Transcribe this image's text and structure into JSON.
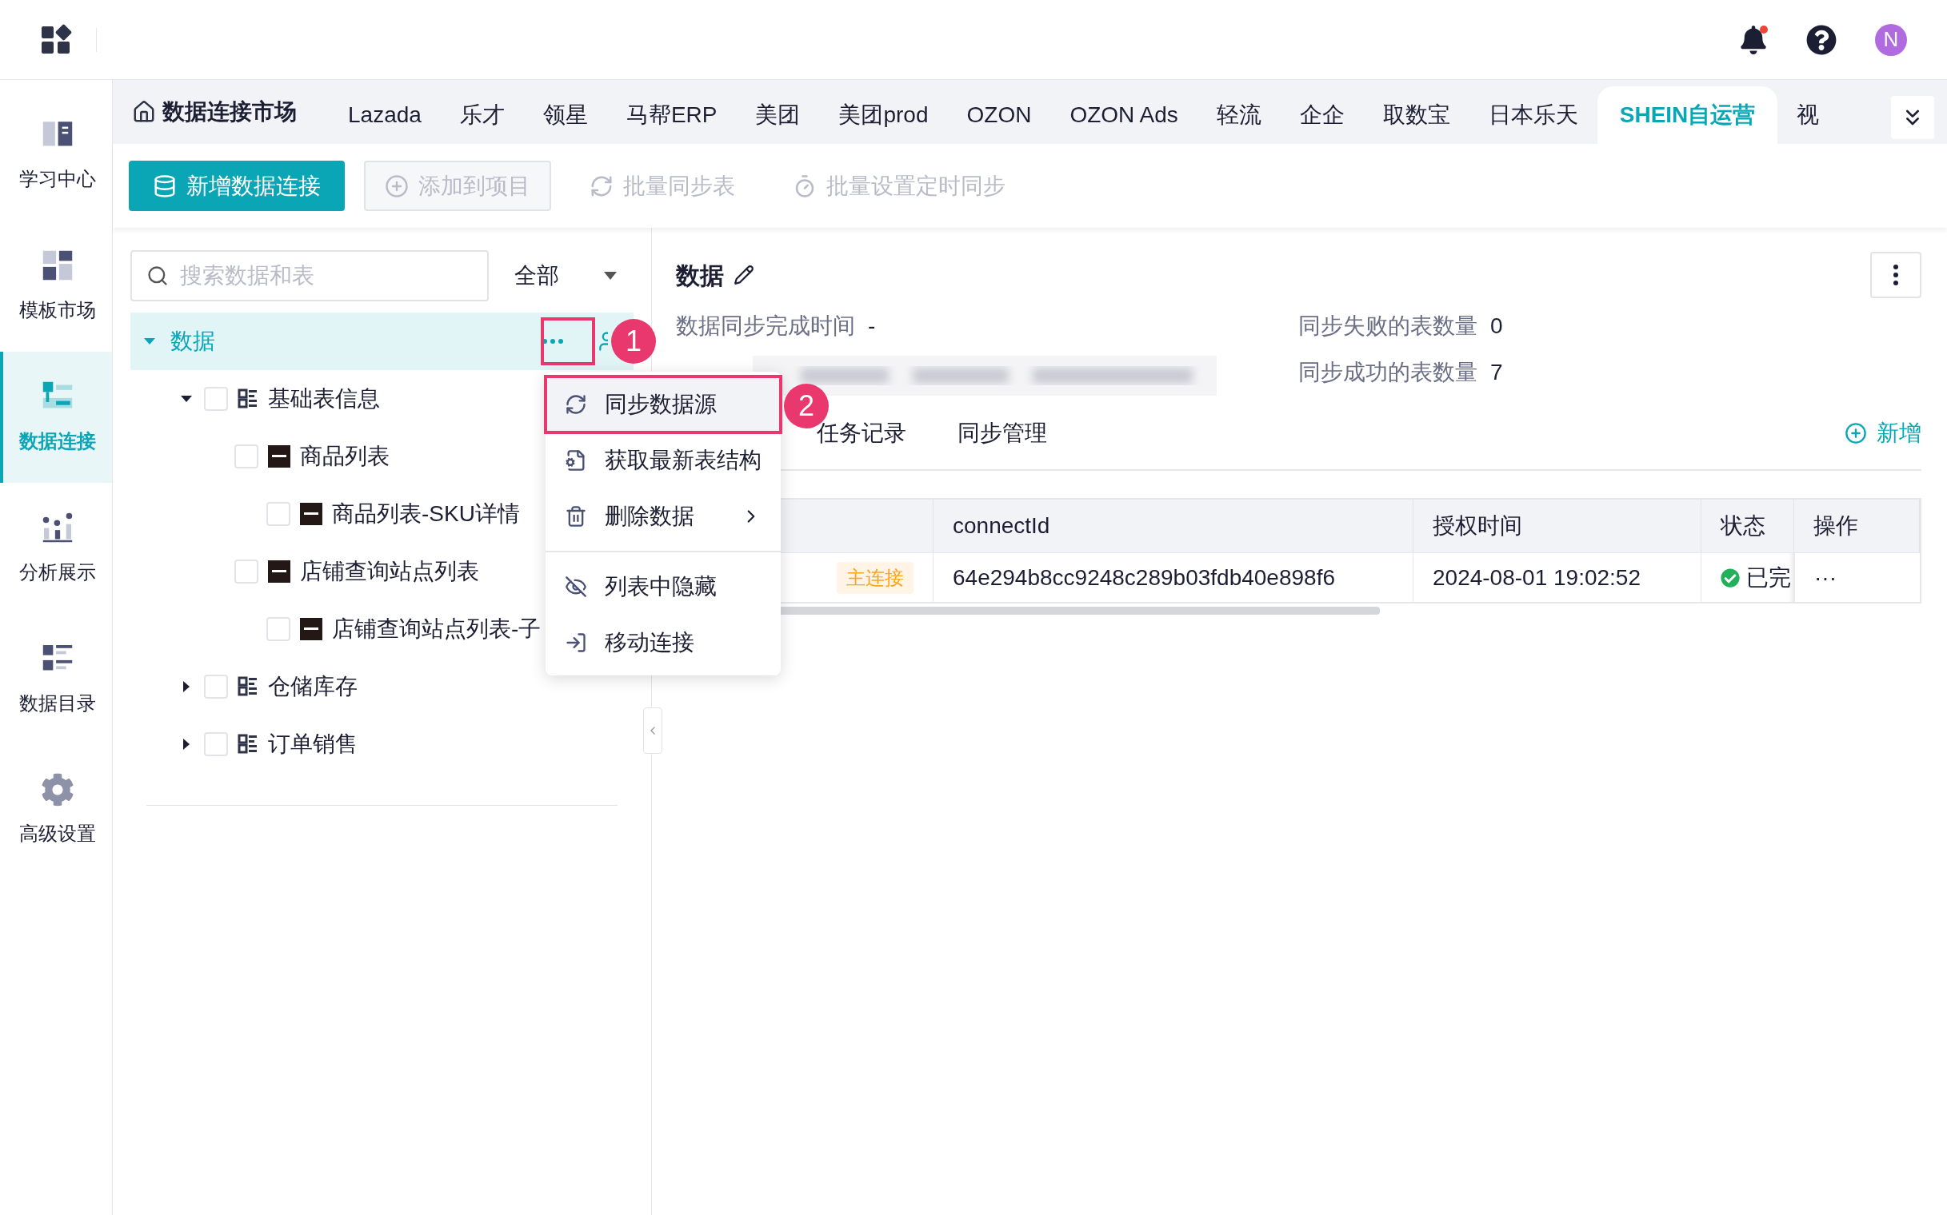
{
  "header": {
    "avatar": "N"
  },
  "sidebar": {
    "items": [
      {
        "label": "学习中心",
        "selected": false
      },
      {
        "label": "模板市场",
        "selected": false
      },
      {
        "label": "数据连接",
        "selected": true
      },
      {
        "label": "分析展示",
        "selected": false
      },
      {
        "label": "数据目录",
        "selected": false
      },
      {
        "label": "高级设置",
        "selected": false
      }
    ]
  },
  "market_tabs": {
    "home": "数据连接市场",
    "tabs": [
      {
        "label": "Lazada",
        "selected": false
      },
      {
        "label": "乐才",
        "selected": false
      },
      {
        "label": "领星",
        "selected": false
      },
      {
        "label": "马帮ERP",
        "selected": false
      },
      {
        "label": "美团",
        "selected": false
      },
      {
        "label": "美团prod",
        "selected": false
      },
      {
        "label": "OZON",
        "selected": false
      },
      {
        "label": "OZON Ads",
        "selected": false
      },
      {
        "label": "轻流",
        "selected": false
      },
      {
        "label": "企企",
        "selected": false
      },
      {
        "label": "取数宝",
        "selected": false
      },
      {
        "label": "日本乐天",
        "selected": false
      },
      {
        "label": "SHEIN自运营",
        "selected": true
      },
      {
        "label": "视",
        "selected": false
      }
    ]
  },
  "toolbar": {
    "buttons": [
      {
        "label": "新增数据连接",
        "kind": "primary",
        "disabled": false
      },
      {
        "label": "添加到项目",
        "kind": "outline",
        "disabled": true
      },
      {
        "label": "批量同步表",
        "kind": "text",
        "disabled": true
      },
      {
        "label": "批量设置定时同步",
        "kind": "text",
        "disabled": true
      }
    ]
  },
  "tree": {
    "search_placeholder": "搜索数据和表",
    "filter": "全部",
    "nodes": [
      {
        "label": "数据",
        "kind": "root",
        "expanded": true,
        "selected": true,
        "children": [
          {
            "label": "基础表信息",
            "kind": "folder",
            "expanded": true,
            "checked": false,
            "children": [
              {
                "label": "商品列表",
                "kind": "table",
                "checked": false,
                "children": [
                  {
                    "label": "商品列表-SKU详情",
                    "kind": "table",
                    "checked": false
                  }
                ]
              },
              {
                "label": "店铺查询站点列表",
                "kind": "table",
                "checked": false,
                "children": [
                  {
                    "label": "店铺查询站点列表-子",
                    "kind": "table",
                    "checked": false
                  }
                ]
              }
            ]
          },
          {
            "label": "仓储库存",
            "kind": "folder",
            "expanded": false,
            "checked": false
          },
          {
            "label": "订单销售",
            "kind": "folder",
            "expanded": false,
            "checked": false
          }
        ]
      }
    ]
  },
  "context_menu": {
    "groups": [
      [
        {
          "label": "同步数据源",
          "submenu": false,
          "highlighted": true
        },
        {
          "label": "获取最新表结构",
          "submenu": false,
          "highlighted": false
        },
        {
          "label": "删除数据",
          "submenu": true,
          "highlighted": false
        }
      ],
      [
        {
          "label": "列表中隐藏",
          "submenu": false,
          "highlighted": false
        },
        {
          "label": "移动连接",
          "submenu": false,
          "highlighted": false
        }
      ]
    ]
  },
  "annotations": [
    {
      "number": "1"
    },
    {
      "number": "2"
    }
  ],
  "detail": {
    "title": "数据",
    "info": [
      {
        "label": "数据同步完成时间",
        "value": "-"
      },
      {
        "label": "同步失败的表数量",
        "value": "0"
      },
      {
        "label": "同步成功的表数量",
        "value": "7"
      }
    ],
    "tabs": [
      {
        "label": "任务记录",
        "selected": false
      },
      {
        "label": "同步管理",
        "selected": false
      }
    ],
    "add": "新增",
    "table": {
      "columns": [
        "connectId",
        "授权时间",
        "状态",
        "操作"
      ],
      "rows": [
        {
          "badge": "主连接",
          "connect_id": "64e294b8cc9248c289b03fdb40e898f6",
          "auth_time": "2024-08-01 19:02:52",
          "status": "已完",
          "ok": true,
          "action": "···"
        }
      ]
    }
  }
}
